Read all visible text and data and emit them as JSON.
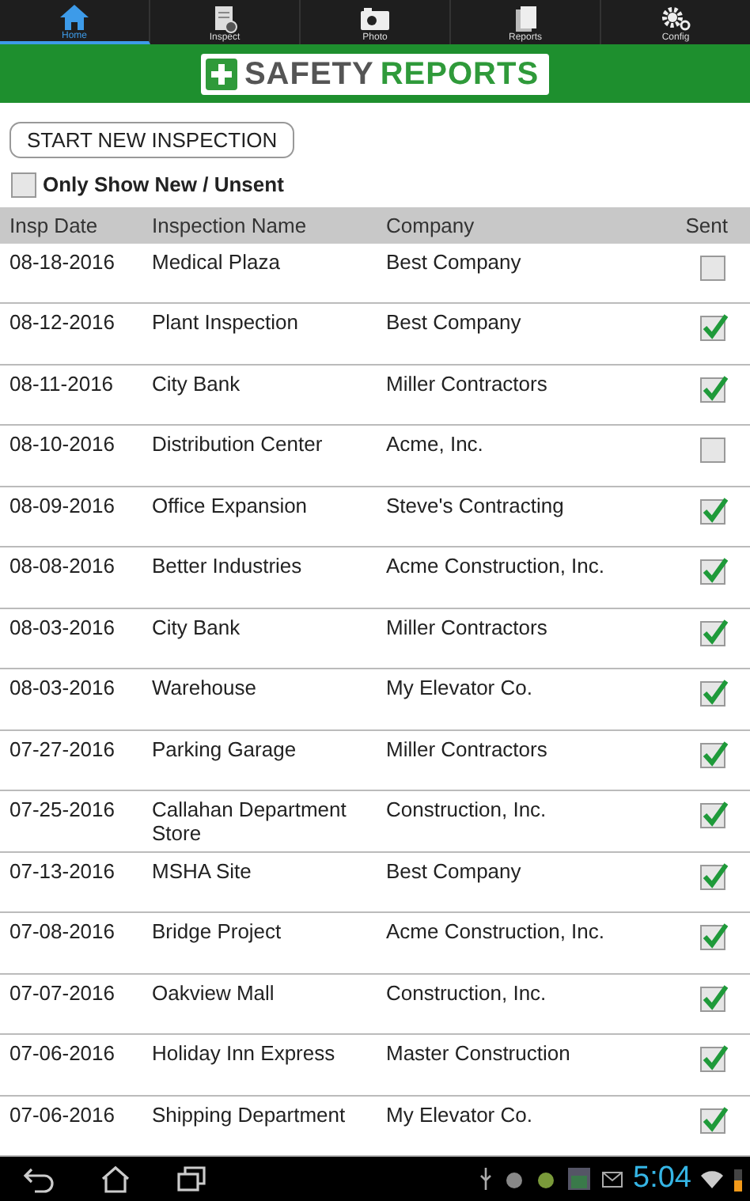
{
  "tabs": [
    {
      "label": "Home",
      "selected": true
    },
    {
      "label": "Inspect",
      "selected": false
    },
    {
      "label": "Photo",
      "selected": false
    },
    {
      "label": "Reports",
      "selected": false
    },
    {
      "label": "Config",
      "selected": false
    }
  ],
  "logo": {
    "word_1": "SAFETY",
    "word_2": "REPORTS"
  },
  "start_button": "START NEW INSPECTION",
  "filter": {
    "label": "Only Show New / Unsent",
    "checked": false
  },
  "table": {
    "columns": [
      "Insp Date",
      "Inspection Name",
      "Company",
      "Sent"
    ],
    "rows": [
      {
        "date": "08-18-2016",
        "name": "Medical Plaza",
        "company": "Best Company",
        "sent": false
      },
      {
        "date": "08-12-2016",
        "name": "Plant Inspection",
        "company": "Best Company",
        "sent": true
      },
      {
        "date": "08-11-2016",
        "name": "City Bank",
        "company": "Miller Contractors",
        "sent": true
      },
      {
        "date": "08-10-2016",
        "name": "Distribution Center",
        "company": "Acme, Inc.",
        "sent": false
      },
      {
        "date": "08-09-2016",
        "name": "Office Expansion",
        "company": "Steve's Contracting",
        "sent": true
      },
      {
        "date": "08-08-2016",
        "name": "Better Industries",
        "company": "Acme Construction, Inc.",
        "sent": true
      },
      {
        "date": "08-03-2016",
        "name": "City Bank",
        "company": "Miller Contractors",
        "sent": true
      },
      {
        "date": "08-03-2016",
        "name": "Warehouse",
        "company": "My Elevator Co.",
        "sent": true
      },
      {
        "date": "07-27-2016",
        "name": "Parking Garage",
        "company": "Miller Contractors",
        "sent": true
      },
      {
        "date": "07-25-2016",
        "name": "Callahan Department Store",
        "company": "Construction, Inc.",
        "sent": true
      },
      {
        "date": "07-13-2016",
        "name": "MSHA Site",
        "company": "Best Company",
        "sent": true
      },
      {
        "date": "07-08-2016",
        "name": "Bridge Project",
        "company": "Acme Construction, Inc.",
        "sent": true
      },
      {
        "date": "07-07-2016",
        "name": "Oakview Mall",
        "company": "Construction, Inc.",
        "sent": true
      },
      {
        "date": "07-06-2016",
        "name": "Holiday Inn Express",
        "company": "Master Construction",
        "sent": true
      },
      {
        "date": "07-06-2016",
        "name": "Shipping Department",
        "company": "My Elevator Co.",
        "sent": true
      }
    ]
  },
  "status_bar": {
    "time": "5:04"
  }
}
